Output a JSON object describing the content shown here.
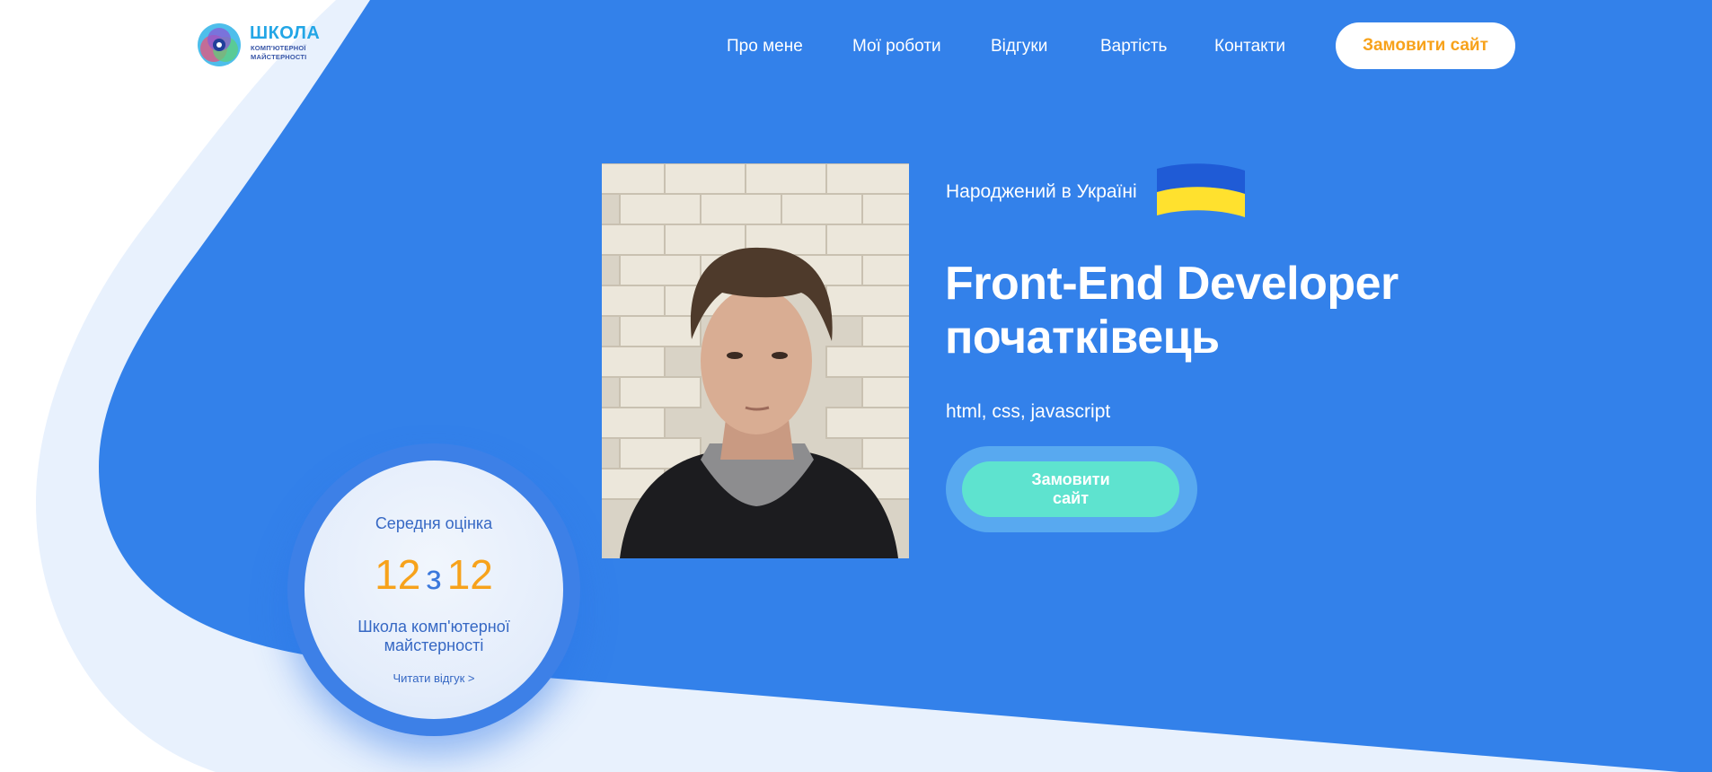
{
  "colors": {
    "primary_blue": "#3381ea",
    "accent_orange": "#f7a21b",
    "accent_mint": "#5ee3cf",
    "light_band": "#e8f1fd",
    "badge_text": "#3668c4"
  },
  "logo": {
    "icon": "school-logo-icon",
    "line1": "ШКОЛА",
    "line2": "КОМП'ЮТЕРНОЇ",
    "line3": "МАЙСТЕРНОСТІ"
  },
  "nav": {
    "items": [
      {
        "label": "Про мене"
      },
      {
        "label": "Мої роботи"
      },
      {
        "label": "Відгуки"
      },
      {
        "label": "Вартість"
      },
      {
        "label": "Контакти"
      }
    ],
    "cta_label": "Замовити сайт"
  },
  "hero": {
    "born_text": "Народжений в Україні",
    "flag_icon": "ukraine-flag-icon",
    "title_line1": "Front-End Developer",
    "title_line2": "початківець",
    "skills": "html, css, javascript",
    "cta_label": "Замовити сайт",
    "photo": "portrait-photo"
  },
  "rating": {
    "title": "Середня оцінка",
    "score": "12",
    "of": "з",
    "max": "12",
    "school": "Школа комп'ютерної майстерності",
    "link": "Читати відгук >"
  }
}
